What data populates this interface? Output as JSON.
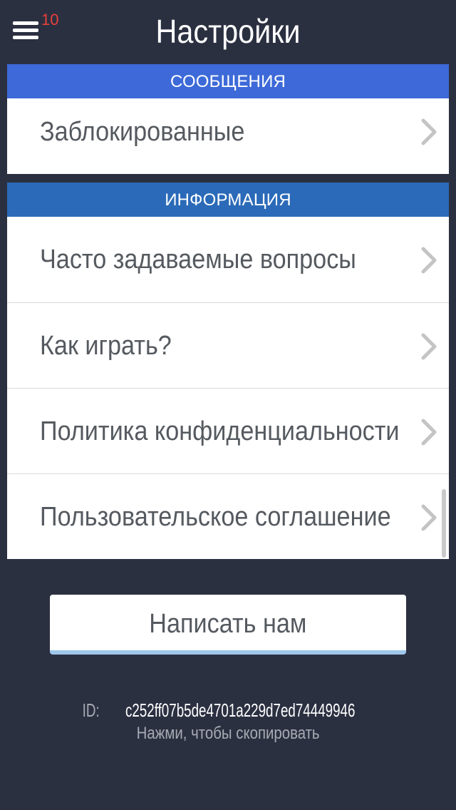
{
  "header": {
    "title": "Настройки",
    "menu_badge": "10",
    "menu_icon": "hamburger-menu-icon"
  },
  "sections": {
    "messages": {
      "title": "СООБЩЕНИЯ",
      "items": [
        {
          "label": "Заблокированные"
        }
      ]
    },
    "info": {
      "title": "ИНФОРМАЦИЯ",
      "items": [
        {
          "label": "Часто задаваемые вопросы"
        },
        {
          "label": "Как играть?"
        },
        {
          "label": "Политика конфиденциальности"
        },
        {
          "label": "Пользовательское соглашение"
        }
      ]
    }
  },
  "contact_button": {
    "label": "Написать нам"
  },
  "device": {
    "id_prefix": "ID:",
    "id_value": "c252ff07b5de4701a229d7ed74449946",
    "copy_hint": "Нажми, чтобы скопировать"
  },
  "colors": {
    "background": "#2b3041",
    "messages_header": "#3d6ad8",
    "info_header": "#2a6ab8",
    "badge": "#e8413a",
    "button_underline": "#9fc6ea"
  }
}
